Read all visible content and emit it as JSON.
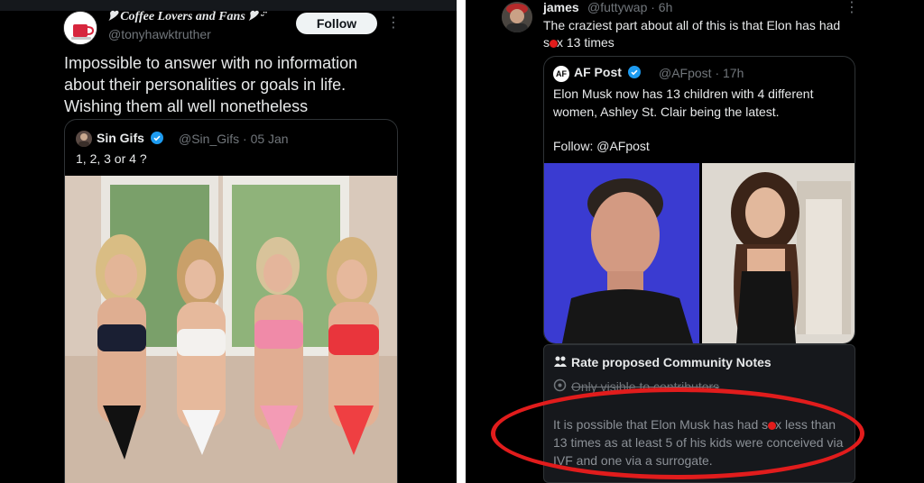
{
  "left_tweet": {
    "author_name": "🎔 Coffee Lovers and Fans 🎔 ᵕ̈",
    "handle": "@tonyhawktruther",
    "follow_label": "Follow",
    "more": "⋮",
    "text": "Impossible to answer with no information about their personalities or goals in life. Wishing them all well nonetheless",
    "quote": {
      "author_name": "Sin Gifs",
      "handle_date": "@Sin_Gifs · 05 Jan",
      "text": "1, 2, 3 or 4 ?"
    }
  },
  "right_tweet": {
    "author_name": "james",
    "handle_time": "@futtywap · 6h",
    "more": "⋮",
    "text_part1": "The craziest part about all of this is that  Elon has had s",
    "text_part2": "x 13 times",
    "quote": {
      "logo": "AF",
      "author_name": "AF Post",
      "handle_time": "@AFpost · 17h",
      "text": "Elon Musk now has 13 children with 4 different women, Ashley St. Clair being the latest.",
      "follow_line": "Follow: @AFpost"
    },
    "community_notes": {
      "title": "Rate proposed Community Notes",
      "visibility": "Only visible to contributors",
      "body_part1": "It is possible that Elon Musk has had s",
      "body_part2": "x less than 13 times as at least 5 of his kids were conceived via IVF and one via a surrogate."
    }
  },
  "colors": {
    "background": "#000000",
    "text": "#e7e9ea",
    "muted": "#71767b",
    "verified_blue": "#1d9bf0",
    "annotation_red": "#e11c1c"
  }
}
